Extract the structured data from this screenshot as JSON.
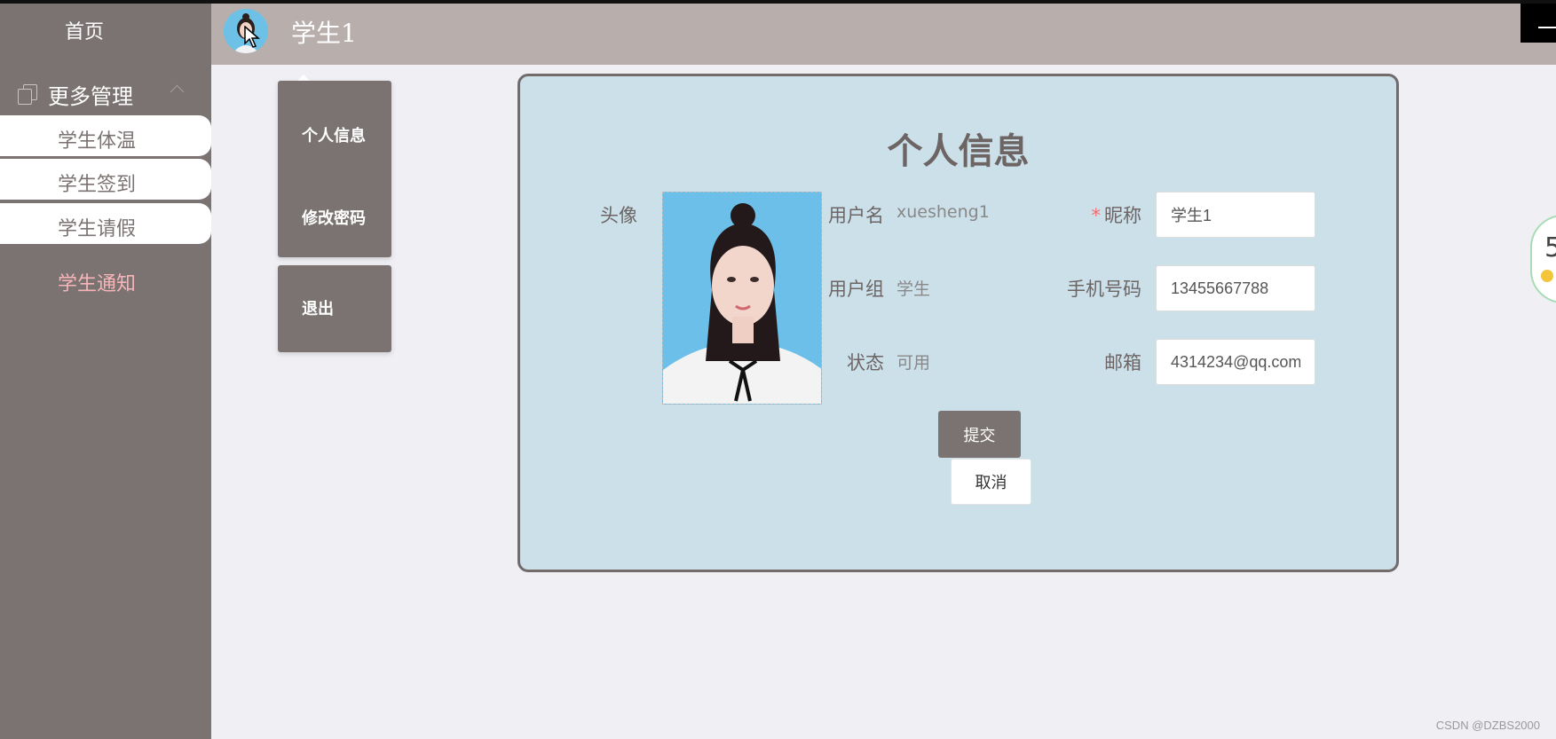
{
  "sidebar": {
    "home_label": "首页",
    "group_label": "更多管理",
    "items": [
      {
        "label": "学生体温"
      },
      {
        "label": "学生签到"
      },
      {
        "label": "学生请假"
      },
      {
        "label": "学生通知"
      }
    ]
  },
  "header": {
    "username": "学生1"
  },
  "dropdown": {
    "items": [
      {
        "label": "个人信息"
      },
      {
        "label": "修改密码"
      },
      {
        "label": "退出"
      }
    ]
  },
  "profile": {
    "title": "个人信息",
    "avatar_label": "头像",
    "username_label": "用户名",
    "username_value": "xuesheng1",
    "usergroup_label": "用户组",
    "usergroup_value": "学生",
    "status_label": "状态",
    "status_value": "可用",
    "nickname_label": "昵称",
    "nickname_required": "*",
    "nickname_value": "学生1",
    "phone_label": "手机号码",
    "phone_value": "13455667788",
    "email_label": "邮箱",
    "email_value": "4314234@qq.com",
    "submit_label": "提交",
    "cancel_label": "取消"
  },
  "widget": {
    "number": "5"
  },
  "watermark": "CSDN @DZBS2000",
  "colors": {
    "sidebar_bg": "#7b7372",
    "header_bg": "#b8afad",
    "card_bg": "#cce0ea",
    "accent_pink": "#f7b5b9",
    "required_red": "#f56c6c"
  }
}
